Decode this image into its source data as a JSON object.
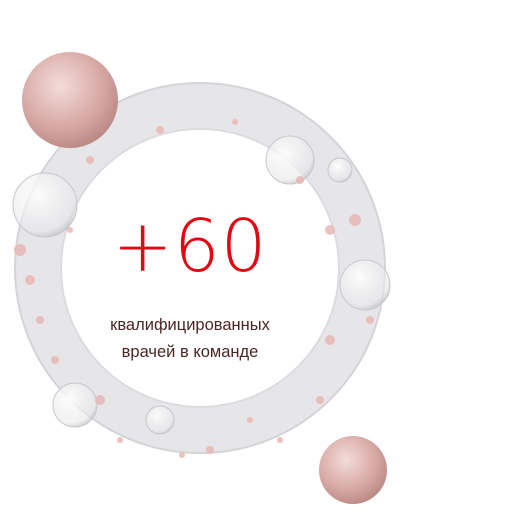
{
  "stat": {
    "value": "+60",
    "caption_line1": "квалифицированных",
    "caption_line2": "врачей в команде"
  },
  "colors": {
    "accent": "#e30613",
    "text": "#4a2626",
    "bubble": "#d9a9a6"
  }
}
